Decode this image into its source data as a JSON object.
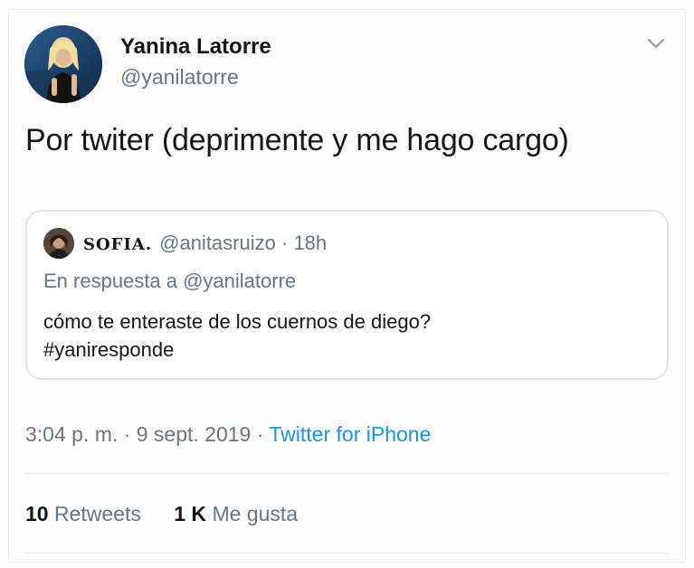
{
  "author": {
    "display_name": "Yanina Latorre",
    "handle": "@yanilatorre"
  },
  "tweet": {
    "text": "Por twiter (deprimente y me hago cargo)"
  },
  "quoted_tweet": {
    "display_name": "SOFIA.",
    "handle": "@anitasruizo",
    "separator": "·",
    "time_ago": "18h",
    "reply_context": "En respuesta a @yanilatorre",
    "text_line1": "cómo te enteraste de los cuernos de diego?",
    "text_line2": "#yaniresponde"
  },
  "meta": {
    "time": "3:04 p. m.",
    "separator1": "·",
    "date": "9 sept. 2019",
    "separator2": "·",
    "source": "Twitter for iPhone"
  },
  "stats": {
    "retweets_count": "10",
    "retweets_label": "Retweets",
    "likes_count": "1 K",
    "likes_label": "Me gusta"
  },
  "icons": {
    "menu": "chevron-down-icon"
  },
  "colors": {
    "text_primary": "#14171a",
    "text_secondary": "#657786",
    "link": "#1b95e0",
    "border": "#dfe5ea"
  }
}
